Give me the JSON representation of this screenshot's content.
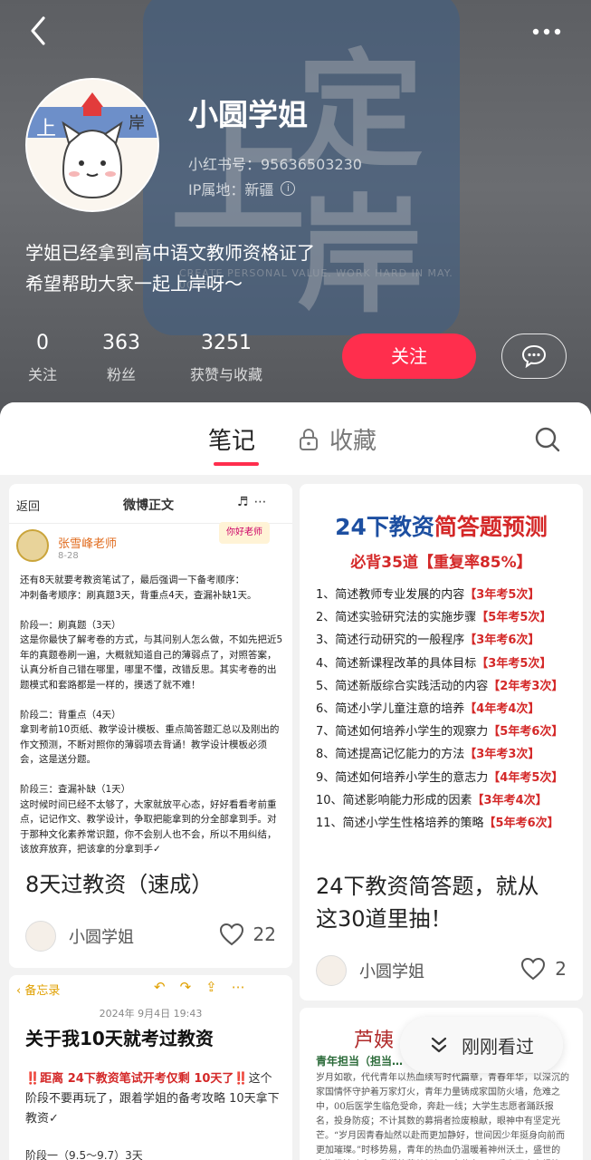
{
  "header": {
    "back_icon": "chevron-left-icon",
    "more_icon": "more-dots-icon"
  },
  "profile": {
    "nickname": "小圆学姐",
    "xhs_id": "小红书号：95636503230",
    "ip_location": "IP属地：新疆",
    "bio_line1": "学姐已经拿到高中语文教师资格证了",
    "bio_line2": "希望帮助大家一起上岸呀～",
    "avatar_text_left": "上",
    "avatar_text_right": "岸",
    "background_watermark": "CREATE PERSONAL VALUE. WORK HARD IN MAY. 0G19S"
  },
  "stats": [
    {
      "value": "0",
      "label": "关注"
    },
    {
      "value": "363",
      "label": "粉丝"
    },
    {
      "value": "3251",
      "label": "获赞与收藏"
    }
  ],
  "actions": {
    "follow_label": "关注",
    "accent_color": "#ff2e4d"
  },
  "tabs": {
    "notes": "笔记",
    "favorites": "收藏"
  },
  "cards": [
    {
      "title": "8天过教资（速成）",
      "author": "小圆学姐",
      "likes": "22",
      "screenshot": {
        "back": "返回",
        "title": "微博正文",
        "user": "张雪峰老师",
        "date": "8-28",
        "badge": "你好老师",
        "text": "还有8天就要考教资笔试了，最后强调一下备考顺序：\n冲刺备考顺序：刷真题3天，背重点4天，查漏补缺1天。\n\n阶段一：刷真题（3天）\n这是你最快了解考卷的方式，与其问别人怎么做，不如先把近5年的真题卷刷一遍，大概就知道自己的薄弱点了，对照答案，认真分析自己错在哪里，哪里不懂，改错反思。其实考卷的出题模式和套路都是一样的，摸透了就不难！\n\n阶段二：背重点（4天）\n拿到考前10页纸、教学设计模板、重点简答题汇总以及刚出的作文预测，不断对照你的薄弱项去背诵！教学设计模板必须会，这是送分题。\n\n阶段三：查漏补缺（1天）\n这时候时间已经不太够了，大家就放平心态，好好看看考前重点，记记作文、教学设计，争取把能拿到的分全部拿到手。对于那种文化素养常识题，你不会别人也不会，所以不用纠结，该放弃放弃，把该拿的分拿到手✓"
      }
    },
    {
      "title_line1": "24下教资简答题，就从",
      "title_line2": "这30道里抽！",
      "author": "小圆学姐",
      "likes": "2",
      "poster": {
        "heading_blue": "24下教资",
        "heading_red": "简答题预测",
        "subheading": "必背35道【重复率85%】",
        "items": [
          {
            "text": "1、简述教师专业发展的内容",
            "tag": "【3年考5次】"
          },
          {
            "text": "2、简述实验研究法的实施步骤",
            "tag": "【5年考5次】"
          },
          {
            "text": "3、简述行动研究的一般程序",
            "tag": "【3年考6次】"
          },
          {
            "text": "4、简述新课程改革的具体目标",
            "tag": "【3年考5次】"
          },
          {
            "text": "5、简述新版综合实践活动的内容",
            "tag": "【2年考3次】"
          },
          {
            "text": "6、简述小学儿童注意的培养",
            "tag": "【4年考4次】"
          },
          {
            "text": "7、简述如何培养小学生的观察力",
            "tag": "【5年考6次】"
          },
          {
            "text": "8、简述提高记忆能力的方法",
            "tag": "【3年考3次】"
          },
          {
            "text": "9、简述如何培养小学生的意志力",
            "tag": "【4年考5次】"
          },
          {
            "text": "10、简述影响能力形成的因素",
            "tag": "【3年考4次】"
          },
          {
            "text": "11、简述小学生性格培养的策略",
            "tag": "【5年考6次】"
          }
        ]
      }
    },
    {
      "memo_back": "备忘录",
      "memo_date": "2024年 9月4日 19:43",
      "memo_title": "关于我10天就考过教资",
      "memo_warn_prefix": "‼️距离 24下教资笔试开考仅剩 10天了‼️",
      "memo_body": "这个阶段不要再玩了，跟着学姐的备考攻略 10天拿下教资✓",
      "memo_foot": "阶段一（9.5～9.7）3天"
    },
    {
      "heading": "芦姨",
      "subheading": "青年担当（担当…",
      "body": "岁月如歌，代代青年以热血续写时代篇章，青春年华，以深沉的家国情怀守护着万家灯火，青年力量铸成家国防火墙，危难之中，00后医学生临危受命，奔赴一线；大学生志愿者踊跃报名，投身防疫；不计其数的募捐者捡废粮献，眼神中有坚定光芒。“岁月因青春灿然以赴而更加静好，世间因少年挺身向前而更加璀璨。”时移势易，青年的热血仍温暖着神州沃土，盛世的大海扬波啸育了我们的蓬勃朝气，余荫之下，后来更应奋楫笃行，在历史长河中踔厉奋发。"
    }
  ],
  "floating": {
    "recent_label": "刚刚看过"
  }
}
